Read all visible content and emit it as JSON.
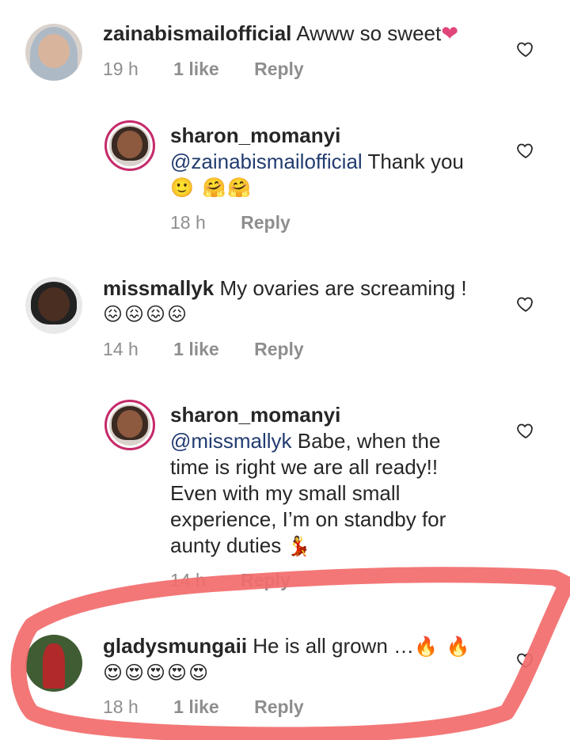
{
  "comments": [
    {
      "username": "zainabismailofficial",
      "text": "Awww so sweet",
      "emoji": "❤",
      "time": "19 h",
      "likes": "1 like",
      "reply": "Reply"
    },
    {
      "username": "sharon_momanyi",
      "mention": "@zainabismailofficial",
      "text": "Thank you",
      "emoji": "🙂 🤗🤗",
      "time": "18 h",
      "reply": "Reply"
    },
    {
      "username": "missmallyk",
      "text": "My ovaries are screaming !",
      "emoji": "😖😖😖😖",
      "time": "14 h",
      "likes": "1 like",
      "reply": "Reply"
    },
    {
      "username": "sharon_momanyi",
      "mention": "@missmallyk",
      "text_line1": "Babe, when the",
      "text_line2": "time is right we are all ready!!",
      "text_line3": "Even with my small small",
      "text_line4": "experience, I’m on standby for",
      "text_line5": "aunty duties",
      "emoji": "💃",
      "time": "14 h",
      "reply": "Reply"
    },
    {
      "username": "gladysmungaii",
      "text": "He is all grown …",
      "emoji_inline": "🔥 🔥",
      "emoji": "😍😍😍😍😍",
      "time": "18 h",
      "likes": "1 like",
      "reply": "Reply"
    }
  ],
  "icons": {
    "like": "heart-outline-icon"
  },
  "colors": {
    "annotation": "#f26b6b",
    "username": "#262626",
    "mention": "#223c70",
    "meta": "#8e8e8e"
  }
}
